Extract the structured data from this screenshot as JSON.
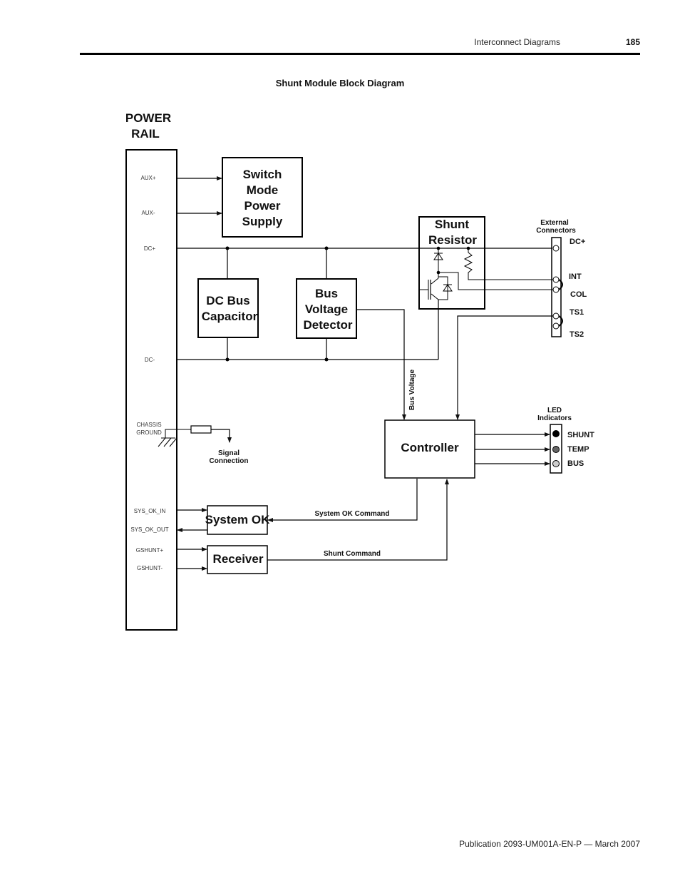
{
  "header": {
    "section_title": "Interconnect Diagrams",
    "page_number": "185"
  },
  "figure": {
    "title": "Shunt Module Block Diagram"
  },
  "footer": {
    "publication": "Publication 2093-UM001A-EN-P — March 2007"
  },
  "diagram": {
    "power_rail": {
      "title_line1": "POWER",
      "title_line2": "RAIL",
      "pins": {
        "aux_plus": "AUX+",
        "aux_minus": "AUX-",
        "dc_plus": "DC+",
        "dc_minus": "DC-",
        "chassis": "CHASSIS",
        "ground": "GROUND",
        "sys_ok_in": "SYS_OK_IN",
        "sys_ok_out": "SYS_OK_OUT",
        "gshunt_plus": "GSHUNT+",
        "gshunt_minus": "GSHUNT-"
      }
    },
    "blocks": {
      "smps": [
        "Switch",
        "Mode",
        "Power",
        "Supply"
      ],
      "dc_bus_capacitor": [
        "DC Bus",
        "Capacitor"
      ],
      "bus_voltage_detector": [
        "Bus",
        "Voltage",
        "Detector"
      ],
      "shunt_resistor": [
        "Shunt",
        "Resistor"
      ],
      "controller": "Controller",
      "system_ok": "System OK",
      "receiver": "Receiver"
    },
    "external_connectors": {
      "title_line1": "External",
      "title_line2": "Connectors",
      "labels": {
        "dc_plus": "DC+",
        "int": "INT",
        "col": "COL",
        "ts1": "TS1",
        "ts2": "TS2"
      }
    },
    "led_indicators": {
      "title_line1": "LED",
      "title_line2": "Indicators",
      "leds": [
        {
          "label": "SHUNT",
          "color": "#000000"
        },
        {
          "label": "TEMP",
          "color": "#666666"
        },
        {
          "label": "BUS",
          "color": "#cccccc"
        }
      ]
    },
    "signals": {
      "bus_voltage": "Bus Voltage",
      "system_ok_command": "System OK Command",
      "shunt_command": "Shunt Command",
      "signal_connection_line1": "Signal",
      "signal_connection_line2": "Connection"
    }
  }
}
